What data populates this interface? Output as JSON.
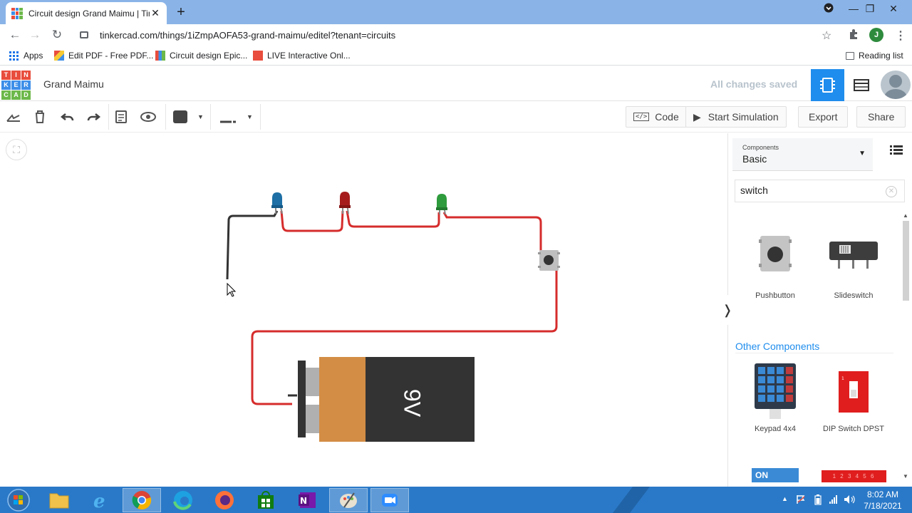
{
  "browser": {
    "tab_title": "Circuit design Grand Maimu | Tin",
    "tab_close": "✕",
    "new_tab": "+",
    "url": "tinkercad.com/things/1iZmpAOFA53-grand-maimu/editel?tenant=circuits",
    "profile_initial": "J",
    "window_buttons": {
      "dropdown": "⌄",
      "minimize": "—",
      "restore": "❐",
      "close": "✕"
    },
    "nav": {
      "back": "←",
      "forward": "→",
      "reload": "↻"
    },
    "bookmarks": [
      {
        "label": "Apps"
      },
      {
        "label": "Edit PDF - Free PDF..."
      },
      {
        "label": "Circuit design Epic..."
      },
      {
        "label": "LIVE Interactive Onl..."
      }
    ],
    "reading_list": "Reading list"
  },
  "app": {
    "logo_letters": [
      "T",
      "I",
      "N",
      "K",
      "E",
      "R",
      "C",
      "A",
      "D"
    ],
    "logo_colors": [
      "#e84d3d",
      "#e84d3d",
      "#e84d3d",
      "#3d8ee8",
      "#3d8ee8",
      "#3d8ee8",
      "#6cb84a",
      "#6cb84a",
      "#6cb84a"
    ],
    "project_title": "Grand Maimu",
    "save_status": "All changes saved"
  },
  "toolbar": {
    "code_label": "Code",
    "simulation_label": "Start Simulation",
    "export_label": "Export",
    "share_label": "Share"
  },
  "panel": {
    "components_label": "Components",
    "components_value": "Basic",
    "search_value": "switch",
    "results": [
      {
        "label": "Pushbutton"
      },
      {
        "label": "Slideswitch"
      }
    ],
    "other_title": "Other Components",
    "other": [
      {
        "label": "Keypad 4x4"
      },
      {
        "label": "DIP Switch DPST"
      }
    ],
    "partial_item_text": "ON",
    "dip_numbers": "1 2 3 4 5 6"
  },
  "circuit": {
    "battery_label": "9V",
    "led_colors": [
      "#1d6fa5",
      "#a61c1c",
      "#2e9b3c"
    ],
    "wire_colors": {
      "positive": "#d62c2c",
      "negative": "#333333"
    }
  },
  "taskbar": {
    "time": "8:02 AM",
    "date": "7/18/2021"
  }
}
